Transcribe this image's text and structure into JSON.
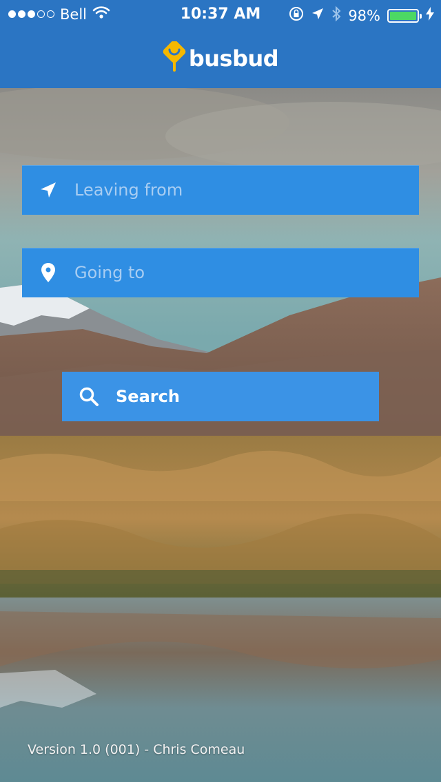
{
  "status_bar": {
    "carrier": "Bell",
    "time": "10:37 AM",
    "battery_percent": "98%",
    "signal_bars_filled": 3,
    "signal_bars_total": 5,
    "icons": [
      "wifi-icon",
      "orientation-lock-icon",
      "location-arrow-icon",
      "bluetooth-icon",
      "battery-icon",
      "charging-bolt-icon"
    ]
  },
  "header": {
    "brand": "busbud",
    "brand_color": "#f5b800",
    "bar_color": "#2b75c3"
  },
  "form": {
    "from_placeholder": "Leaving from",
    "from_icon": "location-arrow-icon",
    "to_placeholder": "Going to",
    "to_icon": "map-pin-icon",
    "field_color": "#2f8ee3",
    "search_label": "Search",
    "search_icon": "search-icon",
    "search_color": "#3b93e6"
  },
  "footer": {
    "version": "Version 1.0 (001) - Chris Comeau"
  }
}
